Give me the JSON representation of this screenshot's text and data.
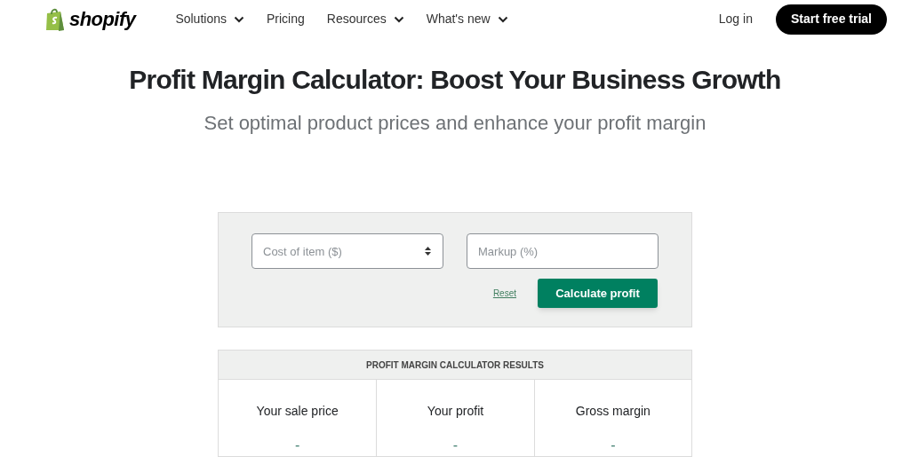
{
  "header": {
    "logo": "shopify",
    "nav": [
      {
        "label": "Solutions",
        "dropdown": true
      },
      {
        "label": "Pricing",
        "dropdown": false
      },
      {
        "label": "Resources",
        "dropdown": true
      },
      {
        "label": "What's new",
        "dropdown": true
      }
    ],
    "login": "Log in",
    "cta": "Start free trial"
  },
  "title": "Profit Margin Calculator: Boost Your Business Growth",
  "subtitle": "Set optimal product prices and enhance your profit margin",
  "calculator": {
    "fields": [
      {
        "placeholder": "Cost of item ($)",
        "kind": "number"
      },
      {
        "placeholder": "Markup (%)",
        "kind": "text"
      }
    ],
    "reset": "Reset",
    "submit": "Calculate profit"
  },
  "results": {
    "heading": "PROFIT MARGIN CALCULATOR RESULTS",
    "items": [
      {
        "label": "Your sale price",
        "value": "-"
      },
      {
        "label": "Your profit",
        "value": "-"
      },
      {
        "label": "Gross margin",
        "value": "-"
      }
    ]
  }
}
